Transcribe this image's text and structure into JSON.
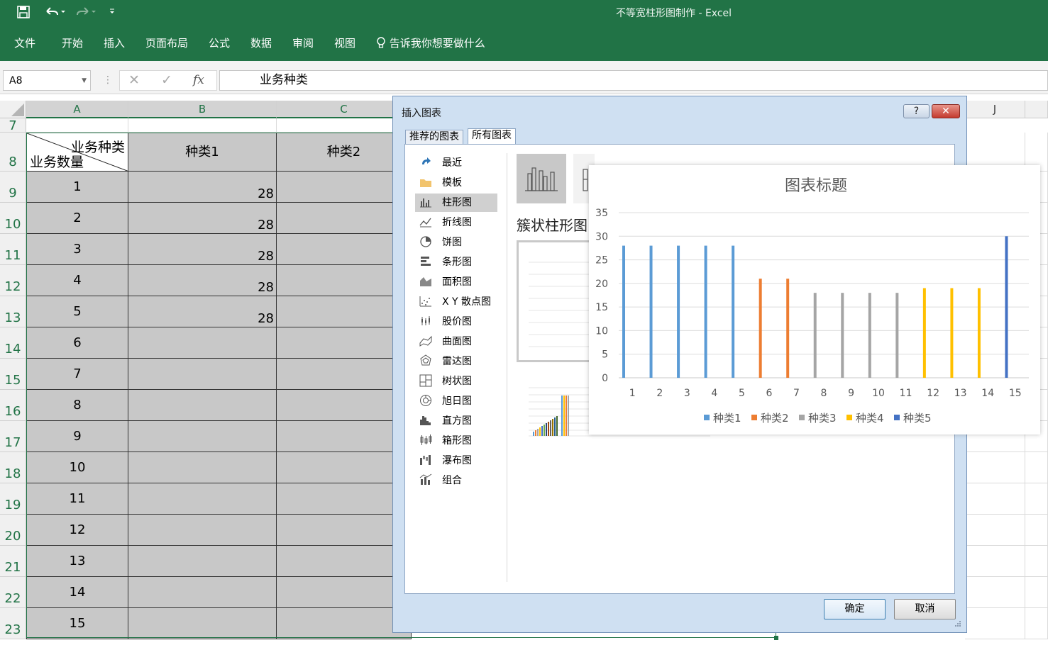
{
  "window": {
    "title": "不等宽柱形图制作  -  Excel"
  },
  "qat": {
    "save_icon": "save-icon",
    "undo_icon": "undo-icon",
    "redo_icon": "redo-icon",
    "customize_icon": "customize-qat-icon"
  },
  "ribbon": {
    "tabs": [
      "文件",
      "开始",
      "插入",
      "页面布局",
      "公式",
      "数据",
      "审阅",
      "视图"
    ],
    "tell_me": "告诉我你想要做什么"
  },
  "formula_bar": {
    "name_box": "A8",
    "fx_label": "fx",
    "content": "业务种类"
  },
  "sheet": {
    "columns": [
      "A",
      "B",
      "C",
      "J"
    ],
    "rows": [
      "7",
      "8",
      "9",
      "10",
      "11",
      "12",
      "13",
      "14",
      "15",
      "16",
      "17",
      "18",
      "19",
      "20",
      "21",
      "22",
      "23"
    ],
    "header": {
      "corner_top": "业务种类",
      "corner_bottom": "业务数量",
      "cat1": "种类1",
      "cat2": "种类2"
    },
    "a_values": [
      "1",
      "2",
      "3",
      "4",
      "5",
      "6",
      "7",
      "8",
      "9",
      "10",
      "11",
      "12",
      "13",
      "14",
      "15"
    ],
    "b_values": [
      "28",
      "28",
      "28",
      "28",
      "28"
    ]
  },
  "dialog": {
    "title": "插入图表",
    "help": "?",
    "close": "✕",
    "tabs": [
      "推荐的图表",
      "所有图表"
    ],
    "categories": [
      "最近",
      "模板",
      "柱形图",
      "折线图",
      "饼图",
      "条形图",
      "面积图",
      "X Y 散点图",
      "股价图",
      "曲面图",
      "雷达图",
      "树状图",
      "旭日图",
      "直方图",
      "箱形图",
      "瀑布图",
      "组合"
    ],
    "selected_category": "柱形图",
    "subtype_title": "簇状柱形图",
    "ok": "确定",
    "cancel": "取消"
  },
  "colors": {
    "excel_green": "#217346",
    "s1": "#5b9bd5",
    "s2": "#ed7d31",
    "s3": "#a5a5a5",
    "s4": "#ffc000",
    "s5": "#4472c4"
  },
  "chart_data": {
    "type": "bar",
    "title": "图表标题",
    "categories": [
      "1",
      "2",
      "3",
      "4",
      "5",
      "6",
      "7",
      "8",
      "9",
      "10",
      "11",
      "12",
      "13",
      "14",
      "15"
    ],
    "series": [
      {
        "name": "种类1",
        "color": "#5b9bd5",
        "values": [
          28,
          28,
          28,
          28,
          28,
          null,
          null,
          null,
          null,
          null,
          null,
          null,
          null,
          null,
          null
        ]
      },
      {
        "name": "种类2",
        "color": "#ed7d31",
        "values": [
          null,
          null,
          null,
          null,
          null,
          21,
          21,
          null,
          null,
          null,
          null,
          null,
          null,
          null,
          null
        ]
      },
      {
        "name": "种类3",
        "color": "#a5a5a5",
        "values": [
          null,
          null,
          null,
          null,
          null,
          null,
          null,
          18,
          18,
          18,
          18,
          null,
          null,
          null,
          null
        ]
      },
      {
        "name": "种类4",
        "color": "#ffc000",
        "values": [
          null,
          null,
          null,
          null,
          null,
          null,
          null,
          null,
          null,
          null,
          null,
          19,
          19,
          19,
          null
        ]
      },
      {
        "name": "种类5",
        "color": "#4472c4",
        "values": [
          null,
          null,
          null,
          null,
          null,
          null,
          null,
          null,
          null,
          null,
          null,
          null,
          null,
          null,
          30
        ]
      }
    ],
    "yticks": [
      "0",
      "5",
      "10",
      "15",
      "20",
      "25",
      "30",
      "35"
    ],
    "ylim": [
      0,
      35
    ],
    "grid": true,
    "legend": "bottom"
  }
}
